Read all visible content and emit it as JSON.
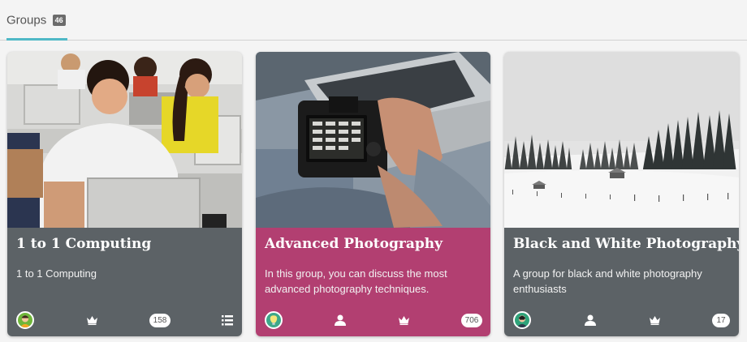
{
  "header": {
    "tab_label": "Groups",
    "tab_count": "46"
  },
  "groups": [
    {
      "title": "1 to 1 Computing",
      "description": "1 to 1 Computing",
      "member_count": "158",
      "color": "#5c6266",
      "icons": [
        "avatar",
        "crown-icon",
        "list-icon"
      ]
    },
    {
      "title": "Advanced Photography",
      "description": "In this group, you can discuss the most advanced photography techniques.",
      "member_count": "706",
      "color": "#b23f71",
      "icons": [
        "avatar",
        "user-icon",
        "crown-icon"
      ]
    },
    {
      "title": "Black and White Photography",
      "description": "A group for black and white photography enthusiasts",
      "member_count": "17",
      "color": "#5c6266",
      "icons": [
        "avatar",
        "user-icon",
        "crown-icon"
      ]
    }
  ]
}
